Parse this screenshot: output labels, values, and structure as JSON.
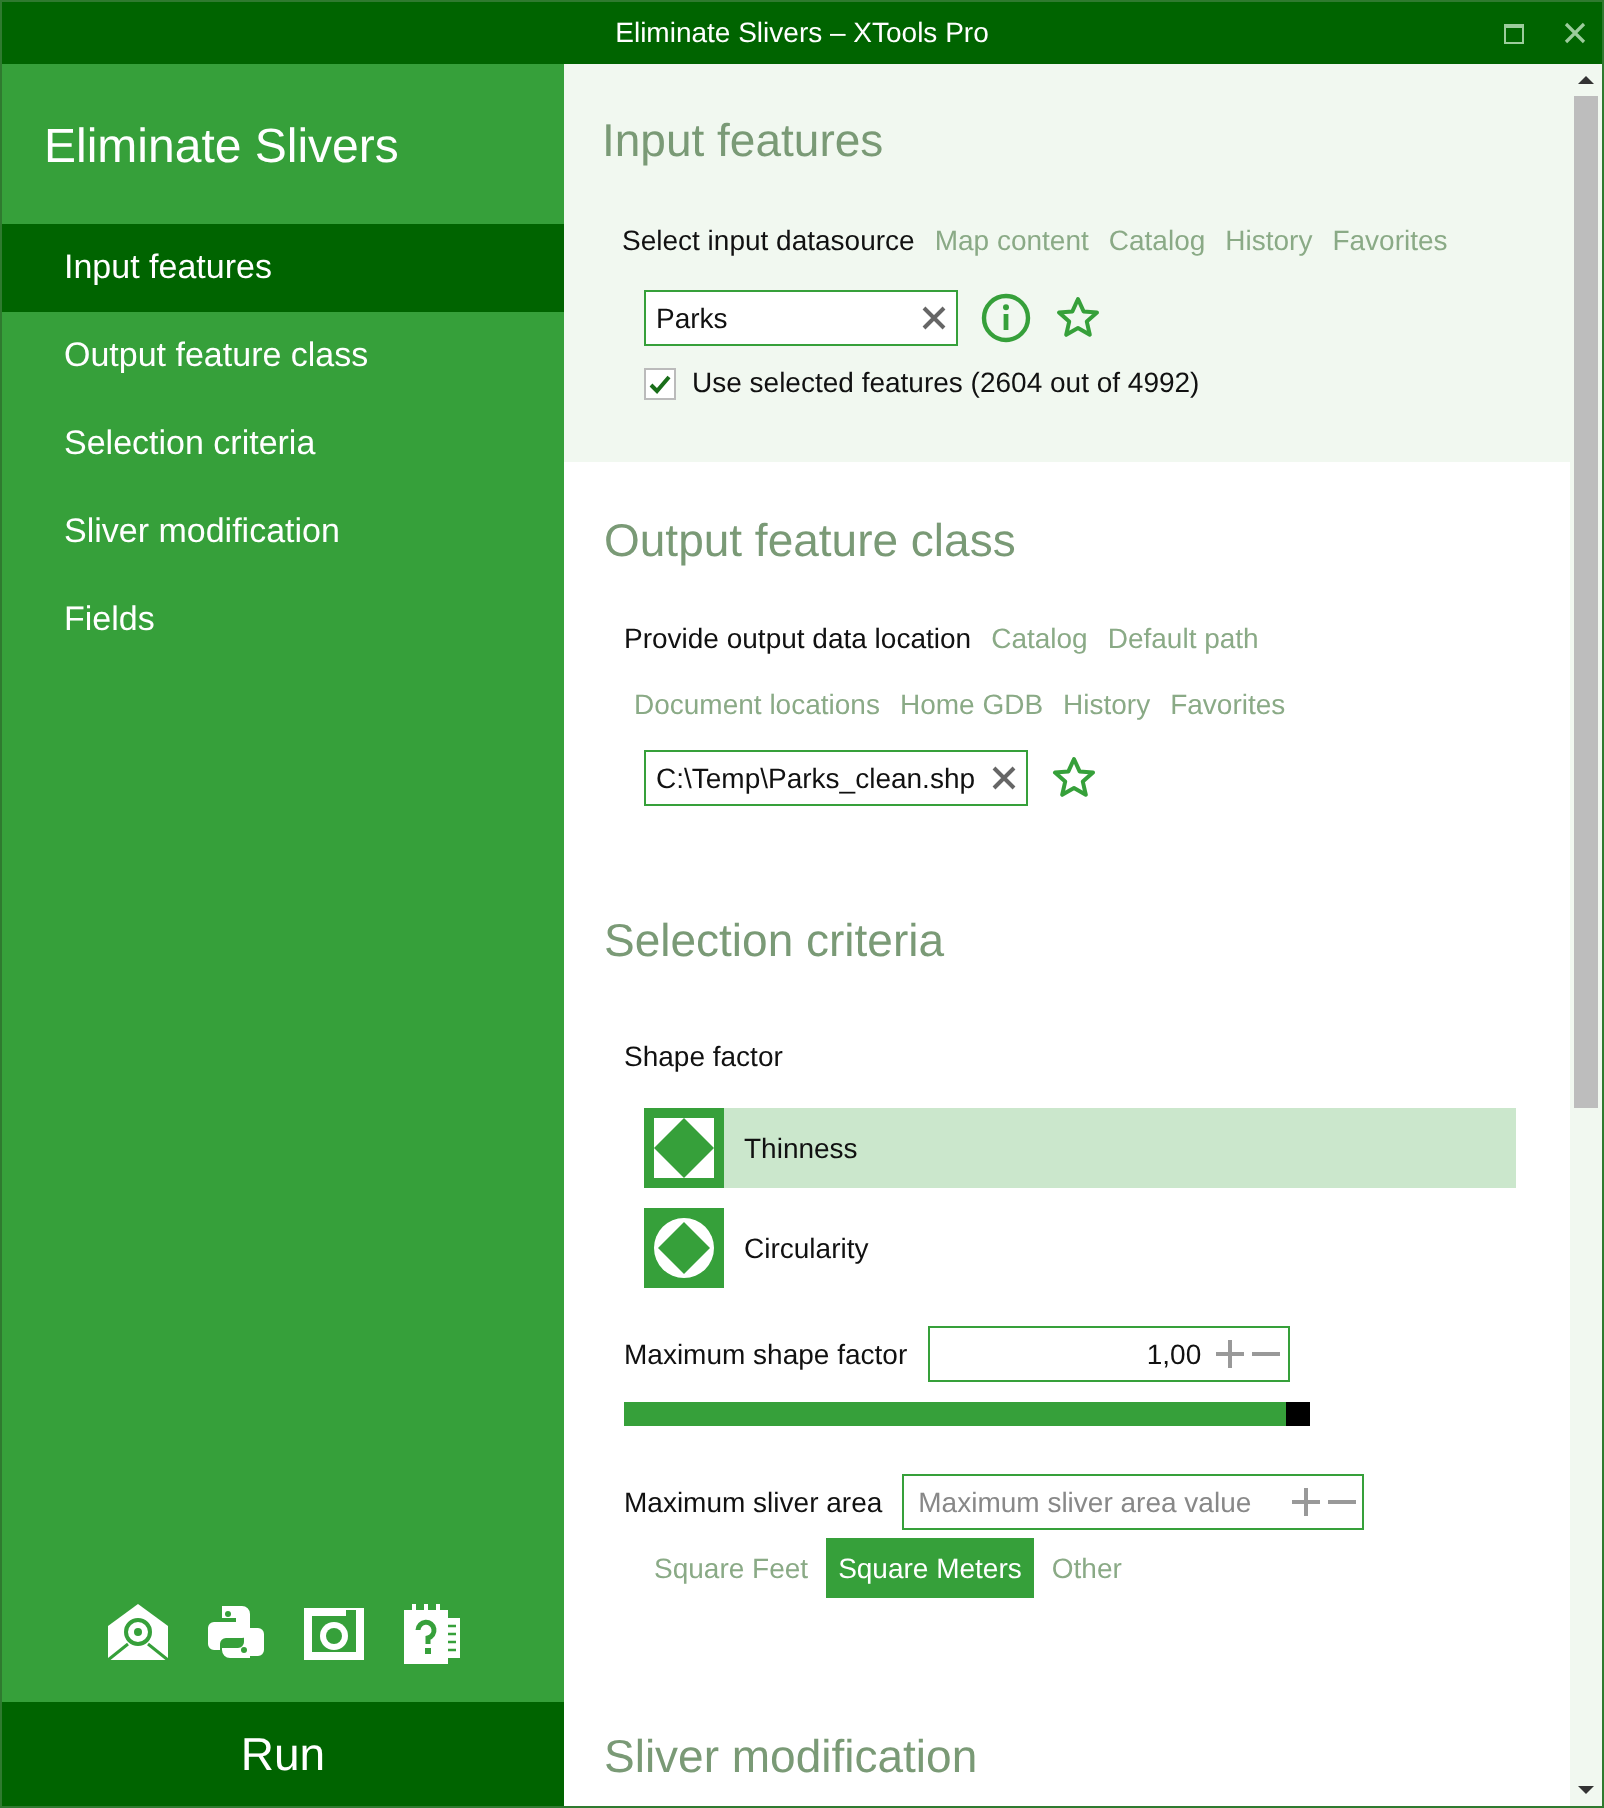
{
  "window": {
    "title": "Eliminate Slivers – XTools Pro"
  },
  "sidebar": {
    "title": "Eliminate Slivers",
    "items": [
      {
        "label": "Input features",
        "selected": true
      },
      {
        "label": "Output feature class",
        "selected": false
      },
      {
        "label": "Selection criteria",
        "selected": false
      },
      {
        "label": "Sliver modification",
        "selected": false
      },
      {
        "label": "Fields",
        "selected": false
      }
    ],
    "run_button": "Run"
  },
  "input_features": {
    "heading": "Input features",
    "datasource_label": "Select input datasource",
    "links": [
      "Map content",
      "Catalog",
      "History",
      "Favorites"
    ],
    "value": "Parks",
    "use_selected": {
      "label": "Use selected features (2604 out of 4992)",
      "checked": true
    }
  },
  "output_feature_class": {
    "heading": "Output feature class",
    "location_label": "Provide output data location",
    "links": [
      "Catalog",
      "Default path",
      "Document locations",
      "Home GDB",
      "History",
      "Favorites"
    ],
    "value": "C:\\Temp\\Parks_clean.shp"
  },
  "selection_criteria": {
    "heading": "Selection criteria",
    "shape_factor_label": "Shape factor",
    "options": [
      {
        "label": "Thinness",
        "kind": "thinness",
        "selected": true
      },
      {
        "label": "Circularity",
        "kind": "circularity",
        "selected": false
      }
    ],
    "max_shape_factor": {
      "label": "Maximum shape factor",
      "value": "1,00",
      "level": 1.0
    },
    "max_area": {
      "label": "Maximum sliver area",
      "placeholder": "Maximum sliver area value"
    },
    "units": [
      {
        "label": "Square Feet",
        "selected": false
      },
      {
        "label": "Square Meters",
        "selected": true
      },
      {
        "label": "Other",
        "selected": false
      }
    ]
  },
  "sliver_modification": {
    "heading": "Sliver modification"
  }
}
